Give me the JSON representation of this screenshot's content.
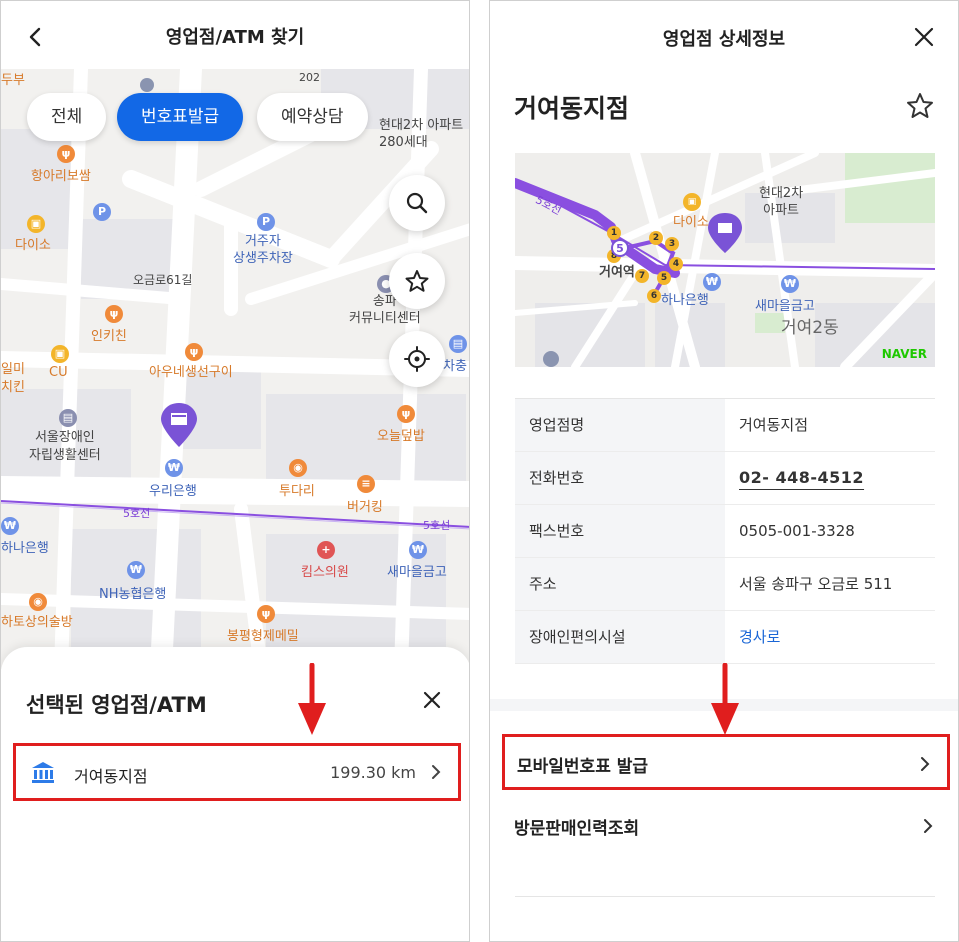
{
  "left": {
    "header": {
      "title": "영업점/ATM 찾기"
    },
    "filters": [
      {
        "label": "전체",
        "active": false
      },
      {
        "label": "번호표발급",
        "active": true
      },
      {
        "label": "예약상담",
        "active": false
      }
    ],
    "map_labels": {
      "l202": "202",
      "hyundai": "현대2차 아파트\n280세대",
      "hangari": "항아리보쌈",
      "daiso": "다이소",
      "parking": "거주자\n상생주차장",
      "ogeum61": "오금로61길",
      "songpa": "송파\n커뮤니티센터",
      "inkichin": "인키친",
      "auneseon": "아우네생선구이",
      "cu": "CU",
      "seoul_center": "서울장애인\n자립생활센터",
      "oneul": "오늘덮밥",
      "woori": "우리은행",
      "tudari": "투다리",
      "burgerking": "버거킹",
      "line5a": "5호선",
      "line5b": "5호선",
      "hana": "하나은행",
      "kims": "킴스의원",
      "saemaul": "새마을금고",
      "nh": "NH농협은행",
      "bongpyeong": "봉평형제메밀",
      "hato": "하토상의술방",
      "edge1": "두부",
      "edge2": "일미\n치킨",
      "edge3": "차충"
    },
    "fabs": [
      "search-icon",
      "star-icon",
      "location-icon"
    ],
    "sheet": {
      "title": "선택된 영업점/ATM",
      "branch_name": "거여동지점",
      "distance": "199.30 km"
    }
  },
  "right": {
    "header": {
      "title": "영업점 상세정보"
    },
    "branch_name": "거여동지점",
    "map": {
      "labels": {
        "line5": "5호선",
        "daiso": "다이소",
        "hyundai": "현대2차\n아파트",
        "geoyeo_station": "거여역",
        "hana": "하나은행",
        "saemaul": "새마을금고",
        "dong": "거여2동",
        "naver": "NAVER"
      },
      "exits": [
        "1",
        "2",
        "3",
        "4",
        "5",
        "6",
        "7",
        "8",
        "5"
      ]
    },
    "info": [
      {
        "label": "영업점명",
        "value": "거여동지점",
        "kind": "text"
      },
      {
        "label": "전화번호",
        "value": "02- 448-4512",
        "kind": "phone"
      },
      {
        "label": "팩스번호",
        "value": "0505-001-3328",
        "kind": "text"
      },
      {
        "label": "주소",
        "value": "서울 송파구 오금로 511",
        "kind": "text"
      },
      {
        "label": "장애인편의시설",
        "value": "경사로",
        "kind": "link"
      }
    ],
    "menu": [
      {
        "label": "모바일번호표 발급",
        "highlighted": true
      },
      {
        "label": "방문판매인력조회",
        "highlighted": false
      }
    ]
  },
  "colors": {
    "accent_blue": "#1268e6",
    "highlight_red": "#e01e1e",
    "line5_purple": "#8a4fe0"
  }
}
